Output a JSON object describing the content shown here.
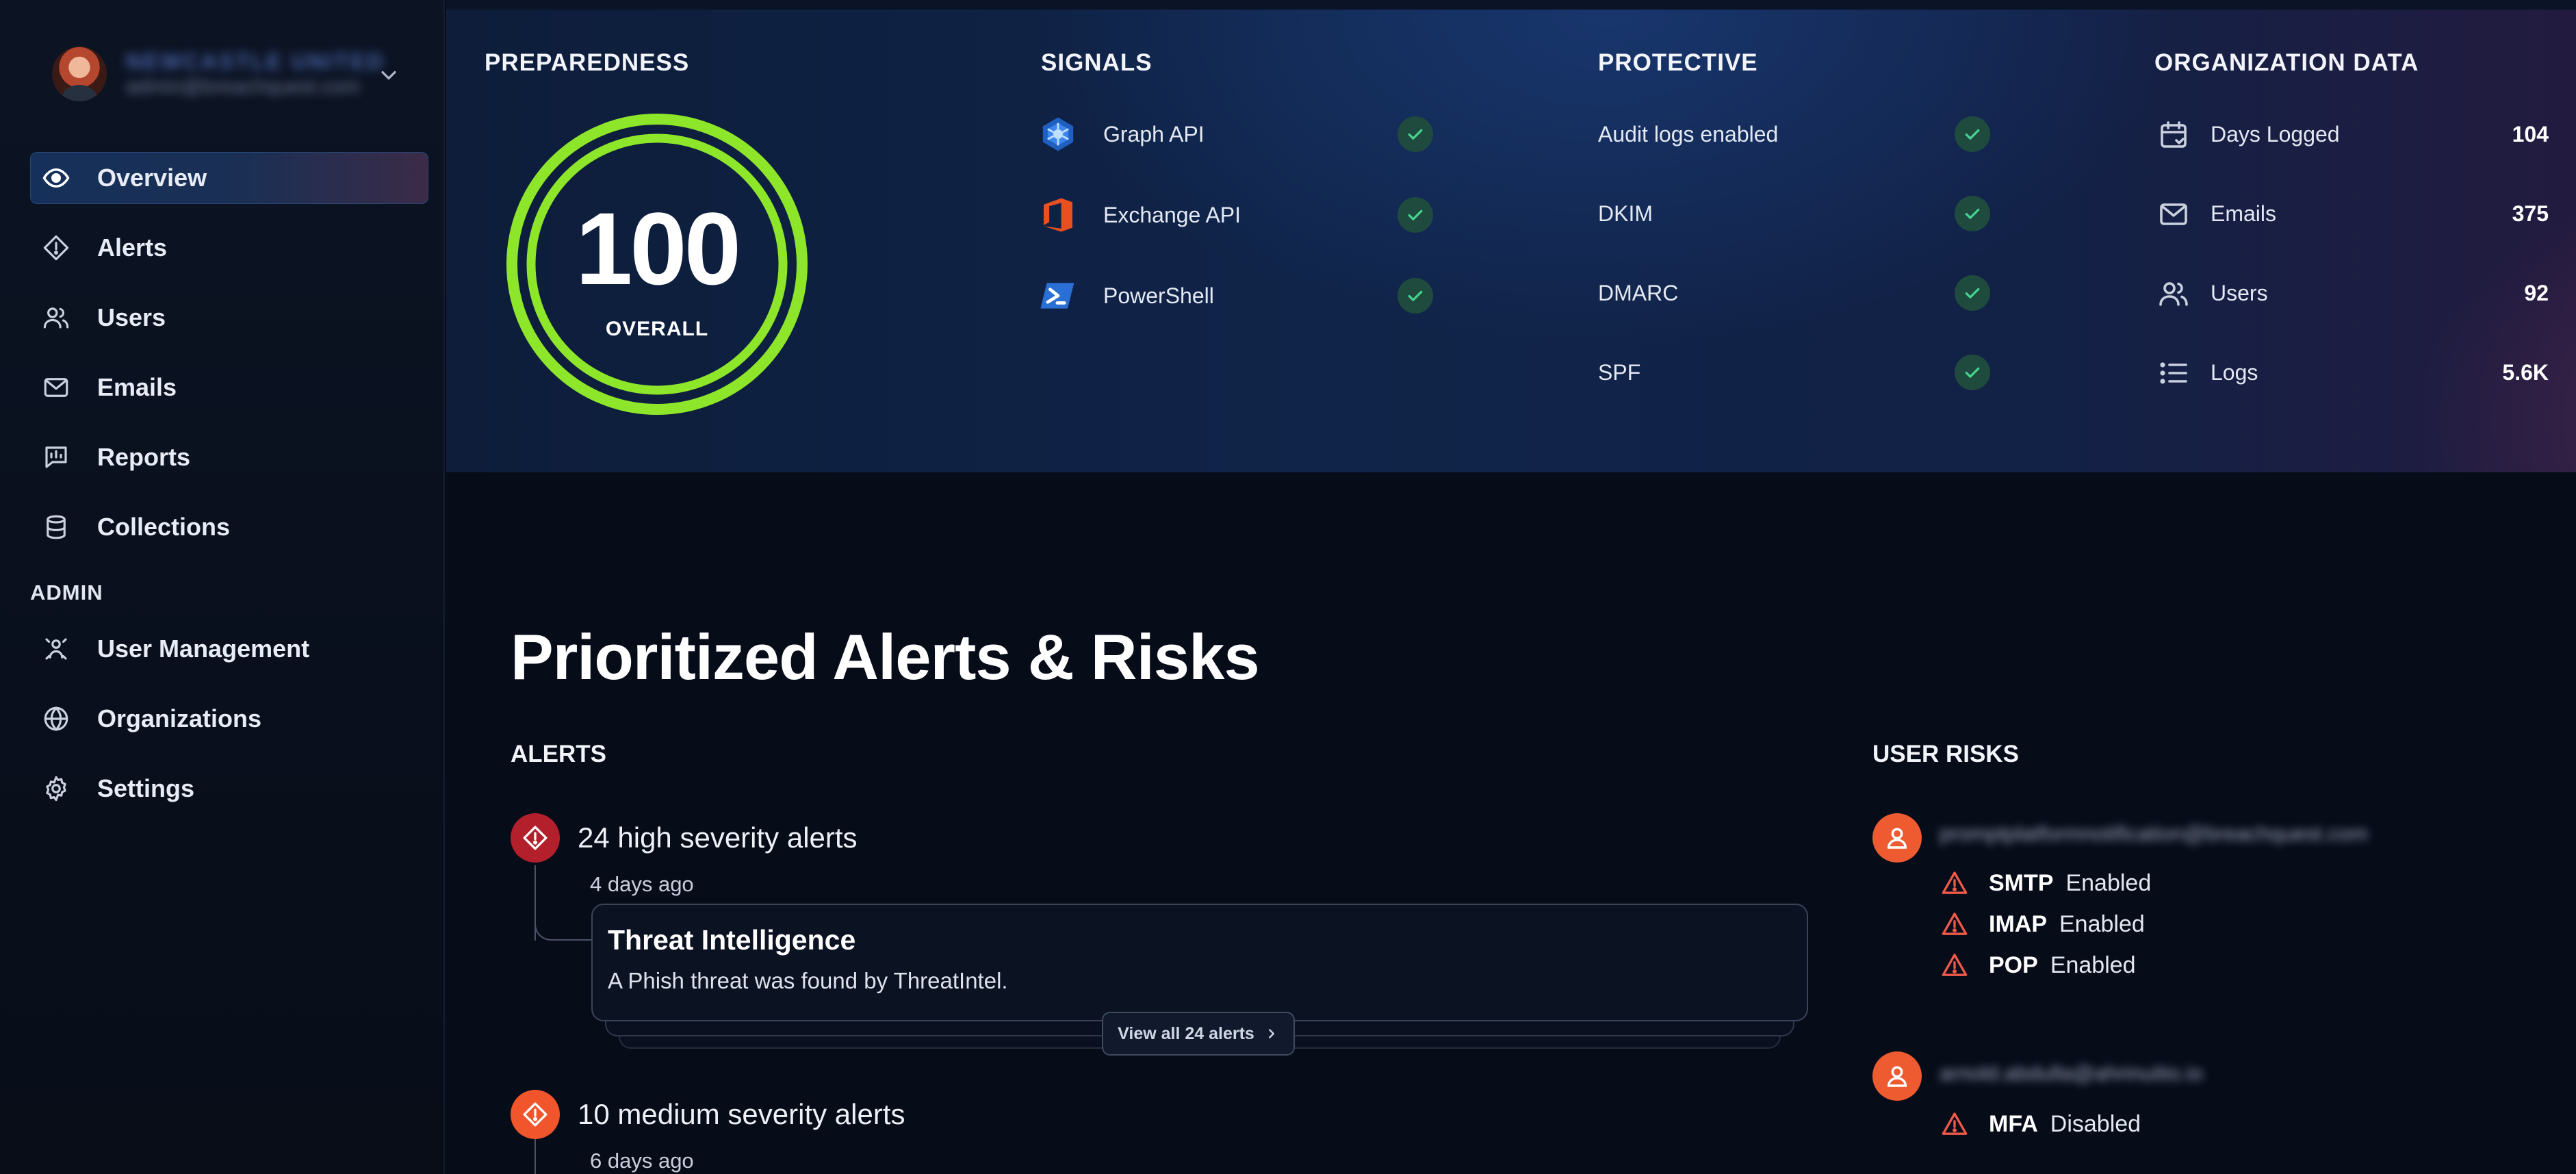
{
  "sidebar": {
    "profile": {
      "name": "NEWCASTLE UNITED",
      "email": "admin@breachquest.com"
    },
    "nav": [
      {
        "label": "Overview",
        "icon": "eye-icon",
        "active": true
      },
      {
        "label": "Alerts",
        "icon": "alert-diamond-icon"
      },
      {
        "label": "Users",
        "icon": "users-icon"
      },
      {
        "label": "Emails",
        "icon": "mail-icon"
      },
      {
        "label": "Reports",
        "icon": "report-icon"
      },
      {
        "label": "Collections",
        "icon": "database-icon"
      }
    ],
    "admin_label": "ADMIN",
    "admin_nav": [
      {
        "label": "User Management",
        "icon": "user-management-icon"
      },
      {
        "label": "Organizations",
        "icon": "globe-icon"
      },
      {
        "label": "Settings",
        "icon": "gear-icon"
      }
    ]
  },
  "preparedness": {
    "title": "PREPAREDNESS",
    "score": "100",
    "score_label": "OVERALL",
    "score_fraction": 1.0,
    "ring_color": "#8ee62a"
  },
  "signals": {
    "title": "SIGNALS",
    "items": [
      {
        "label": "Graph API",
        "icon": "graph-api-icon",
        "status": "ok"
      },
      {
        "label": "Exchange API",
        "icon": "office-icon",
        "status": "ok"
      },
      {
        "label": "PowerShell",
        "icon": "powershell-icon",
        "status": "ok"
      }
    ]
  },
  "protective": {
    "title": "PROTECTIVE",
    "items": [
      {
        "label": "Audit logs enabled",
        "status": "ok"
      },
      {
        "label": "DKIM",
        "status": "ok"
      },
      {
        "label": "DMARC",
        "status": "ok"
      },
      {
        "label": "SPF",
        "status": "ok"
      }
    ]
  },
  "organization": {
    "title": "ORGANIZATION DATA",
    "items": [
      {
        "label": "Days Logged",
        "value": "104",
        "icon": "calendar-icon"
      },
      {
        "label": "Emails",
        "value": "375",
        "icon": "mail-icon"
      },
      {
        "label": "Users",
        "value": "92",
        "icon": "users-icon"
      },
      {
        "label": "Logs",
        "value": "5.6K",
        "icon": "list-icon"
      }
    ]
  },
  "main": {
    "title": "Prioritized Alerts & Risks",
    "alerts_heading": "ALERTS",
    "alerts": [
      {
        "title": "24 high severity alerts",
        "time": "4 days ago",
        "severity": "high",
        "card_title": "Threat Intelligence",
        "card_desc": "A Phish threat was found by ThreatIntel.",
        "view_all": "View all 24 alerts"
      },
      {
        "title": "10 medium severity alerts",
        "time": "6 days ago",
        "severity": "medium"
      }
    ],
    "risks_heading": "USER RISKS",
    "user_risks": [
      {
        "email": "promptplatformnotification@breachquest.com",
        "risks": [
          {
            "protocol": "SMTP",
            "state": "Enabled"
          },
          {
            "protocol": "IMAP",
            "state": "Enabled"
          },
          {
            "protocol": "POP",
            "state": "Enabled"
          }
        ]
      },
      {
        "email": "arnold.abdulla@ahrinuitio.io",
        "risks": [
          {
            "protocol": "MFA",
            "state": "Disabled"
          }
        ]
      }
    ]
  },
  "colors": {
    "accent_green": "#8ee62a",
    "check_bg": "#1f4a3e",
    "check_fg": "#46d48f",
    "high": "#b3202c",
    "medium": "#f0552b",
    "risk_warning": "#f05a4a"
  }
}
